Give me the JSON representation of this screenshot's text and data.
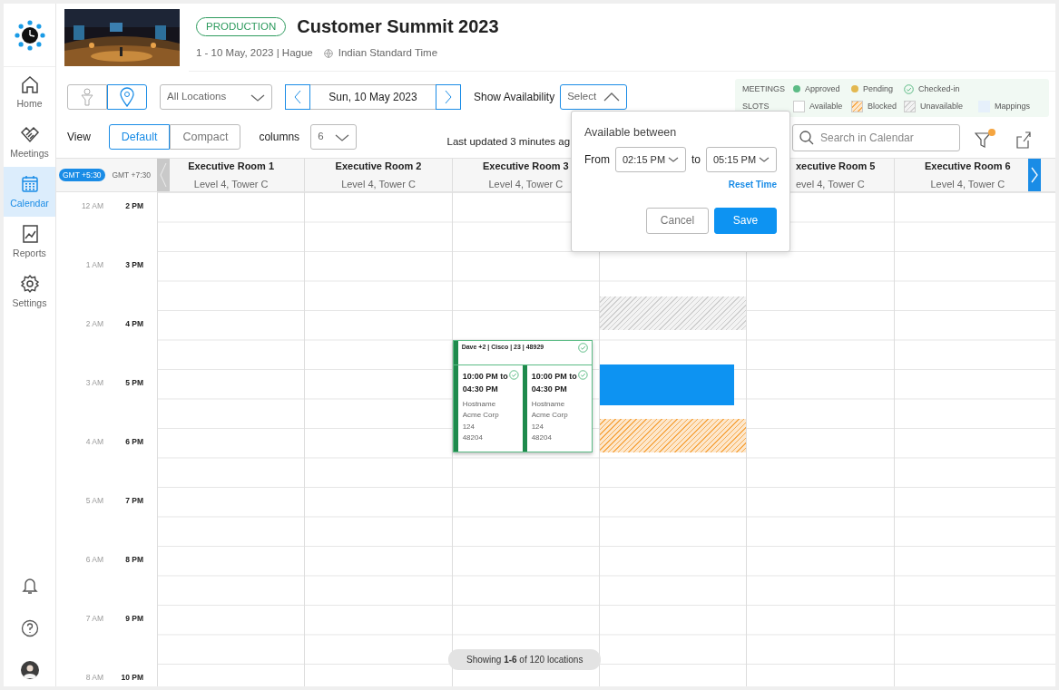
{
  "sidebar": {
    "items": [
      {
        "kind": "home",
        "label": "Home",
        "selected": false
      },
      {
        "kind": "meetings",
        "label": "Meetings",
        "selected": false
      },
      {
        "kind": "calendar",
        "label": "Calendar",
        "selected": true
      },
      {
        "kind": "reports",
        "label": "Reports",
        "selected": false
      },
      {
        "kind": "settings",
        "label": "Settings",
        "selected": false
      }
    ],
    "bottom_items": [
      {
        "kind": "bell"
      },
      {
        "kind": "help"
      },
      {
        "kind": "avatar"
      }
    ]
  },
  "event": {
    "badge": "PRODUCTION",
    "title": "Customer Summit 2023",
    "subtitle": "1 - 10 May, 2023 | Hague",
    "timezone": "Indian Standard Time"
  },
  "toolbar": {
    "view_toggle": [
      {
        "kind": "person",
        "selected": false
      },
      {
        "kind": "location",
        "selected": true
      }
    ],
    "location_select": "All Locations",
    "date": "Sun, 10 May 2023",
    "availability_label": "Show Availability",
    "availability_select": {
      "placeholder": "Select",
      "expanded": true
    },
    "view_label": "View",
    "view_modes": [
      {
        "label": "Default",
        "selected": true
      },
      {
        "label": "Compact",
        "selected": false
      }
    ],
    "columns_label": "columns",
    "columns_value": "6",
    "last_updated": "Last updated 3 minutes ag",
    "search": {
      "placeholder": "Search in Calendar"
    },
    "filter_active": true
  },
  "legend": {
    "meetings_label": "MEETINGS",
    "meetings": [
      {
        "kind": "dot",
        "label": "Approved",
        "color": "#5cbb85"
      },
      {
        "kind": "dot",
        "label": "Pending",
        "color": "#e3b850"
      },
      {
        "kind": "check",
        "label": "Checked-in"
      }
    ],
    "slots_label": "SLOTS",
    "slots": [
      {
        "kind": "available",
        "label": "Available"
      },
      {
        "kind": "blocked",
        "label": "Blocked"
      },
      {
        "kind": "unavailable",
        "label": "Unavailable"
      },
      {
        "kind": "mappings",
        "label": "Mappings"
      }
    ]
  },
  "calendar": {
    "timezones": [
      {
        "label": "GMT +5:30",
        "selected": true
      },
      {
        "label": "GMT +7:30",
        "selected": false
      }
    ],
    "hours": [
      {
        "secondary": "12 AM",
        "primary": "2 PM"
      },
      {
        "secondary": "1 AM",
        "primary": "3 PM"
      },
      {
        "secondary": "2 AM",
        "primary": "4 PM"
      },
      {
        "secondary": "3 AM",
        "primary": "5 PM"
      },
      {
        "secondary": "4 AM",
        "primary": "6 PM"
      },
      {
        "secondary": "5 AM",
        "primary": "7 PM"
      },
      {
        "secondary": "6 AM",
        "primary": "8 PM"
      },
      {
        "secondary": "7 AM",
        "primary": "9 PM"
      },
      {
        "secondary": "8 AM",
        "primary": "10 PM"
      }
    ],
    "rooms": [
      {
        "name": "Executive Room 1",
        "location": "Level 4, Tower C"
      },
      {
        "name": "Executive Room 2",
        "location": "Level 4, Tower C"
      },
      {
        "name": "Executive Room 3",
        "location": "Level 4, Tower C",
        "meeting_group": {
          "title": "Dave +2 | Cisco | 23 | 48929",
          "checked_in": true,
          "color": "#1e8a4c",
          "meetings": [
            {
              "time": "10:00 PM to 04:30 PM",
              "lines": [
                "Hostname",
                "Acme Corp",
                "124",
                "48204"
              ],
              "checked_in": true
            },
            {
              "time": "10:00 PM to 04:30 PM",
              "lines": [
                "Hostname",
                "Acme Corp",
                "124",
                "48204"
              ],
              "checked_in": true
            }
          ]
        }
      },
      {
        "slots": [
          {
            "kind": "unavailable"
          },
          {
            "kind": "selected"
          },
          {
            "kind": "blocked"
          }
        ]
      },
      {
        "name": "xecutive Room 5",
        "location": "evel 4, Tower C"
      },
      {
        "name": "Executive Room 6",
        "location": "Level 4, Tower C"
      }
    ]
  },
  "popover": {
    "title": "Available between",
    "from_label": "From",
    "from": "02:15 PM",
    "to_label": "to",
    "to": "05:15 PM",
    "reset": "Reset Time",
    "buttons": [
      "Cancel",
      "Save"
    ]
  },
  "footer": {
    "text": "Showing **1-6** of 120 locations"
  }
}
